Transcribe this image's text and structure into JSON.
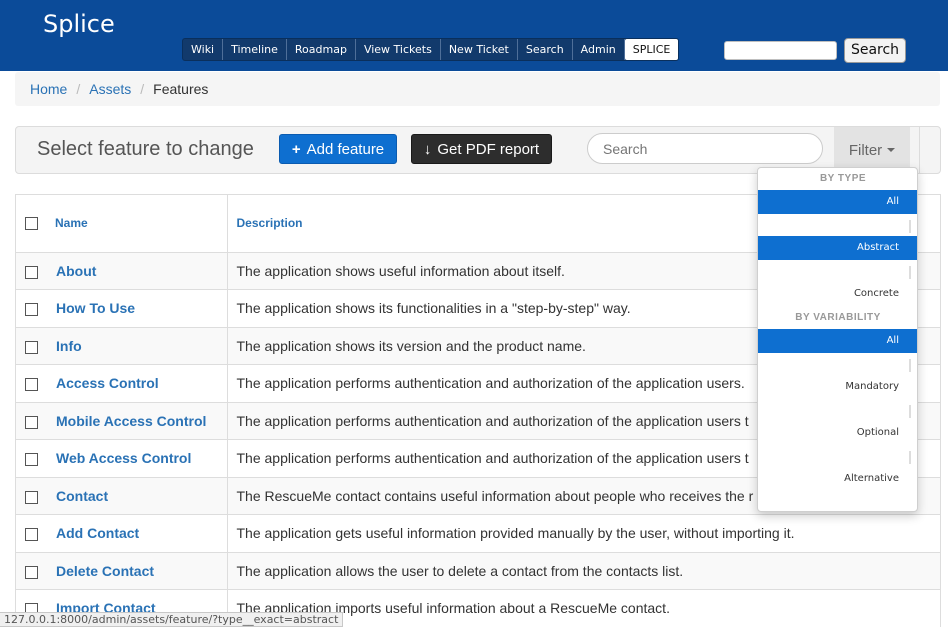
{
  "header": {
    "brand": "Splice",
    "nav": [
      "Wiki",
      "Timeline",
      "Roadmap",
      "View Tickets",
      "New Ticket",
      "Search",
      "Admin",
      "SPLICE"
    ],
    "active_nav": "SPLICE",
    "search_button": "Search"
  },
  "breadcrumb": {
    "home": "Home",
    "assets": "Assets",
    "current": "Features",
    "separator": "/"
  },
  "toolbar": {
    "title": "Select feature to change",
    "add_button": "Add feature",
    "pdf_button": "Get PDF report",
    "search_placeholder": "Search",
    "filter_label": "Filter",
    "add_icon": "plus-icon",
    "pdf_icon": "download-arrow-icon"
  },
  "table": {
    "headers": {
      "name": "Name",
      "description": "Description"
    },
    "rows": [
      {
        "name": "About",
        "description": "The application shows useful information about itself."
      },
      {
        "name": "How To Use",
        "description": "The application shows its functionalities in a \"step-by-step\" way."
      },
      {
        "name": "Info",
        "description": "The application shows its version and the product name."
      },
      {
        "name": "Access Control",
        "description": "The application performs authentication and authorization of the application users."
      },
      {
        "name": "Mobile Access Control",
        "description": "The application performs authentication and authorization of the application users t"
      },
      {
        "name": "Web Access Control",
        "description": "The application performs authentication and authorization of the application users t"
      },
      {
        "name": "Contact",
        "description": "The RescueMe contact contains useful information about people who receives the r"
      },
      {
        "name": "Add Contact",
        "description": "The application gets useful information provided manually by the user, without importing it."
      },
      {
        "name": "Delete Contact",
        "description": "The application allows the user to delete a contact from the contacts list."
      },
      {
        "name": "Import Contact",
        "description": "The application imports useful information about a RescueMe contact."
      }
    ]
  },
  "filter_dropdown": {
    "type_header": "BY TYPE",
    "type_items": [
      "All",
      "Abstract",
      "Concrete"
    ],
    "variability_header": "BY VARIABILITY",
    "variability_items": [
      "All",
      "Mandatory",
      "Optional",
      "Alternative"
    ],
    "selected_color": "#0e6fd0"
  },
  "statusbar": {
    "url": "127.0.0.1:8000/admin/assets/feature/?type__exact=abstract"
  },
  "colors": {
    "header_bg": "#0b4b99",
    "link": "#2a72b5",
    "primary": "#0e6fd0",
    "dark_button": "#2d2d2d"
  }
}
